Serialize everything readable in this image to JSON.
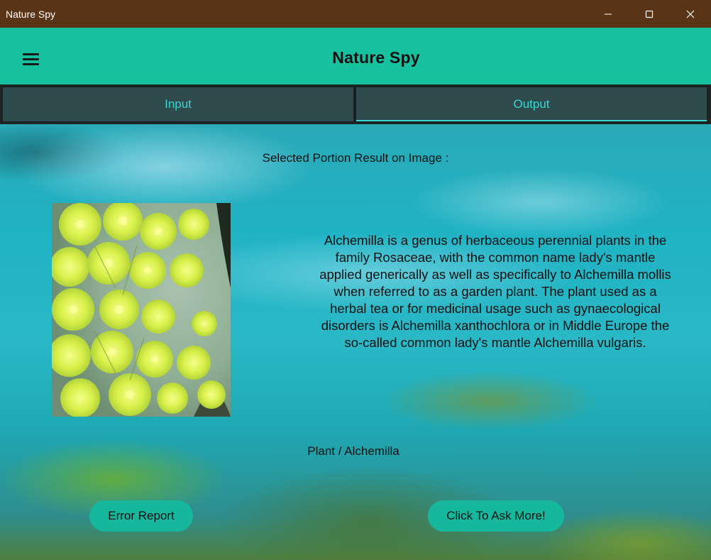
{
  "window": {
    "title": "Nature Spy"
  },
  "appbar": {
    "title": "Nature Spy"
  },
  "tabs": [
    {
      "label": "Input",
      "active": false
    },
    {
      "label": "Output",
      "active": true
    }
  ],
  "output": {
    "result_label": "Selected Portion Result on Image :",
    "description": "Alchemilla is a genus of herbaceous perennial plants in the family Rosaceae, with the common name lady's mantle applied generically as well as specifically to Alchemilla mollis when referred to as a garden plant. The plant used as a herbal tea or for medicinal usage such as gynaecological disorders is Alchemilla xanthochlora or in Middle Europe the so-called common lady's mantle Alchemilla vulgaris.",
    "classification": "Plant / Alchemilla"
  },
  "buttons": {
    "error_report": "Error Report",
    "ask_more": "Click To Ask More!"
  },
  "icons": {
    "menu": "hamburger-menu-icon",
    "minimize": "minimize-icon",
    "maximize": "maximize-icon",
    "close": "close-icon"
  },
  "colors": {
    "titlebar": "#5a3416",
    "appbar": "#16c1a0",
    "tab_bg": "#2f4b4d",
    "tab_text": "#39d7d0",
    "button": "#16b79c"
  }
}
